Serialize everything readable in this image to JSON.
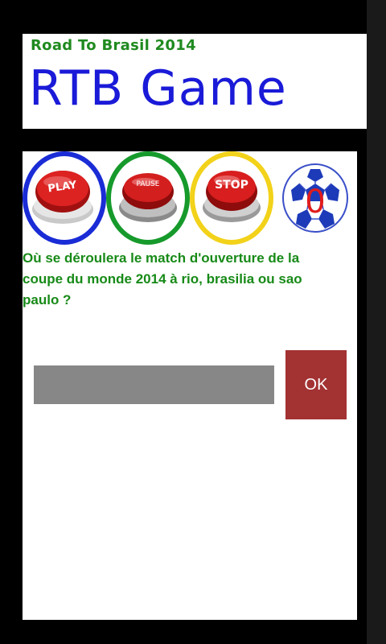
{
  "header": {
    "subtitle": "Road To Brasil 2014",
    "title": "RTB Game"
  },
  "controls": {
    "play": {
      "label": "PLAY",
      "icon": "play-button-icon",
      "ring_color": "#1a2cd6"
    },
    "pause": {
      "label": "PAUSE",
      "icon": "pause-button-icon",
      "ring_color": "#169a2b"
    },
    "stop": {
      "label": "STOP",
      "icon": "stop-button-icon",
      "ring_color": "#f2d21a"
    },
    "score": {
      "value": "0",
      "icon": "soccer-ball-icon"
    }
  },
  "question": {
    "text": "Où se déroulera le match d'ouverture de la coupe du monde 2014 à rio, brasilia ou sao paulo ?"
  },
  "answer": {
    "value": "",
    "placeholder": ""
  },
  "ok_button": {
    "label": "OK"
  },
  "colors": {
    "title": "#1a1ad8",
    "subtitle": "#1f8a1f",
    "question": "#178a17",
    "input_bg": "#878787",
    "ok_bg": "#a33233",
    "button_red": "#d81e1e",
    "score_red": "#e01b1b"
  }
}
